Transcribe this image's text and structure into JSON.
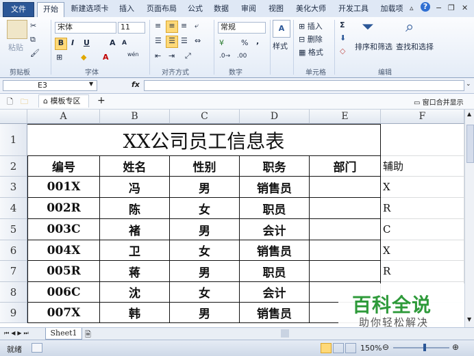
{
  "ribbon_tabs": [
    "文件",
    "开始",
    "新建选项卡",
    "插入",
    "页面布局",
    "公式",
    "数据",
    "审阅",
    "视图",
    "美化大师",
    "开发工具",
    "加载项"
  ],
  "window_controls": {
    "minimize": "−",
    "restore": "❐",
    "close": "✕"
  },
  "clipboard": {
    "paste": "粘贴",
    "label": "剪贴板"
  },
  "font": {
    "name": "宋体",
    "size": "11",
    "bold": "B",
    "italic": "I",
    "underline": "U",
    "grow": "A",
    "shrink": "A",
    "label": "字体",
    "wen": "wén"
  },
  "alignment": {
    "label": "对齐方式"
  },
  "number": {
    "format": "常规",
    "percent": "%",
    "comma": ",",
    "label": "数字"
  },
  "styles": {
    "label": "样式"
  },
  "cells": {
    "insert": "插入",
    "delete": "删除",
    "format": "格式",
    "label": "单元格"
  },
  "editing": {
    "sigma": "Σ",
    "sort_filter": "排序和筛选",
    "find_select": "查找和选择",
    "label": "编辑"
  },
  "name_box": "E3",
  "fx": "fx",
  "workbook_tabs": {
    "template_zone": "模板专区",
    "add": "+",
    "merge_windows": "窗口合并显示"
  },
  "columns": [
    "A",
    "B",
    "C",
    "D",
    "E",
    "F"
  ],
  "rows": [
    "1",
    "2",
    "3",
    "4",
    "5",
    "6",
    "7",
    "8",
    "9"
  ],
  "table_title": "XX公司员工信息表",
  "headers": [
    "编号",
    "姓名",
    "性别",
    "职务",
    "部门",
    "辅助"
  ],
  "records": [
    [
      "001X",
      "冯",
      "男",
      "销售员",
      "",
      "X"
    ],
    [
      "002R",
      "陈",
      "女",
      "职员",
      "",
      "R"
    ],
    [
      "003C",
      "褚",
      "男",
      "会计",
      "",
      "C"
    ],
    [
      "004X",
      "卫",
      "女",
      "销售员",
      "",
      "X"
    ],
    [
      "005R",
      "蒋",
      "男",
      "职员",
      "",
      "R"
    ],
    [
      "006C",
      "沈",
      "女",
      "会计",
      "",
      ""
    ],
    [
      "007X",
      "韩",
      "男",
      "销售员",
      "",
      ""
    ]
  ],
  "sheet_tab": "Sheet1",
  "status": {
    "ready": "就绪",
    "zoom": "150%"
  },
  "watermark": {
    "title": "百科全说",
    "subtitle": "助你轻松解决"
  },
  "colors": {
    "file_tab": "#2b5797",
    "watermark_green": "#2e9a3a",
    "ribbon_bg": "#e4ecf7"
  }
}
